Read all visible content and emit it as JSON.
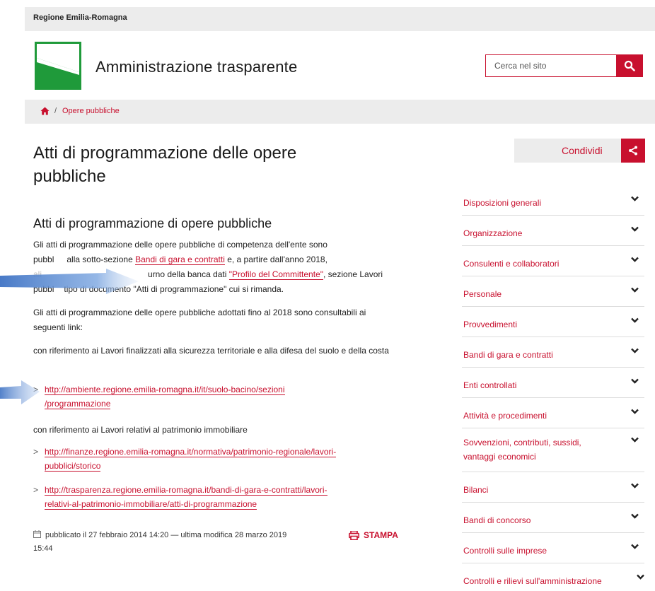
{
  "topbar": {
    "region": "Regione Emilia-Romagna"
  },
  "header": {
    "site_title": "Amministrazione trasparente",
    "search_placeholder": "Cerca nel sito"
  },
  "breadcrumb": {
    "separator": "/",
    "current": "Opere pubbliche"
  },
  "share": {
    "label": "Condividi"
  },
  "main": {
    "title": "Atti di programmazione delle opere pubbliche",
    "section_title": "Atti di programmazione di opere pubbliche",
    "para1": {
      "line1": "Gli atti di programmazione delle opere pubbliche di competenza dell'ente sono",
      "line2_a": "pubbl",
      "line2_b": "alla sotto-sezione ",
      "link1": "Bandi di gara e contratti",
      "line2_c": " e, a partire dall'anno 2018,",
      "line3_a": "ali",
      "line3_b": "urno della banca dati ",
      "link2": "\"Profilo del Committente\"",
      "line3_c": ", sezione Lavori",
      "line4_a": "pubbl",
      "line4_b": "tipo di documento \"Atti di programmazione\" cui si rimanda."
    },
    "para2": "Gli atti di programmazione delle opere pubbliche adottati fino al 2018 sono consultabili ai seguenti link:",
    "para3": "con riferimento ai Lavori finalizzati alla sicurezza territoriale e alla difesa del suolo e della costa",
    "link_a_1": "http://ambiente.regione.emilia-romagna.it/it/suolo-bacino/sezioni",
    "link_a_2": "/programmazione",
    "para4": "con riferimento ai Lavori relativi al patrimonio immobiliare",
    "link_b_1": "http://finanze.regione.emilia-romagna.it/normativa/patrimonio-regionale/lavori-",
    "link_b_2": "pubblici/storico",
    "link_c_1": "http://trasparenza.regione.emilia-romagna.it/bandi-di-gara-e-contratti/lavori-",
    "link_c_2": "relativi-al-patrimonio-immobiliare/atti-di-programmazione",
    "meta_line1": "pubblicato il 27 febbraio 2014 14:20 — ultima modifica 28 marzo 2019",
    "meta_line2": "15:44",
    "print_label": "STAMPA"
  },
  "sidenav": {
    "items": [
      {
        "label": "Disposizioni generali"
      },
      {
        "label": "Organizzazione"
      },
      {
        "label": "Consulenti e collaboratori"
      },
      {
        "label": "Personale"
      },
      {
        "label": "Provvedimenti"
      },
      {
        "label": "Bandi di gara e contratti"
      },
      {
        "label": "Enti controllati"
      },
      {
        "label": "Attività e procedimenti"
      },
      {
        "label": "Sovvenzioni, contributi, sussidi, vantaggi economici"
      },
      {
        "label": "Bilanci"
      },
      {
        "label": "Bandi di concorso"
      },
      {
        "label": "Controlli sulle imprese"
      },
      {
        "label": "Controlli e rilievi sull'amministrazione"
      }
    ]
  },
  "colors": {
    "accent": "#c8102e",
    "logo_green": "#1f9a3a",
    "bar_grey": "#ececec"
  },
  "icons": [
    "search-icon",
    "home-icon",
    "share-icon",
    "chevron-down-icon",
    "chevron-right-icon",
    "calendar-icon",
    "print-icon"
  ]
}
